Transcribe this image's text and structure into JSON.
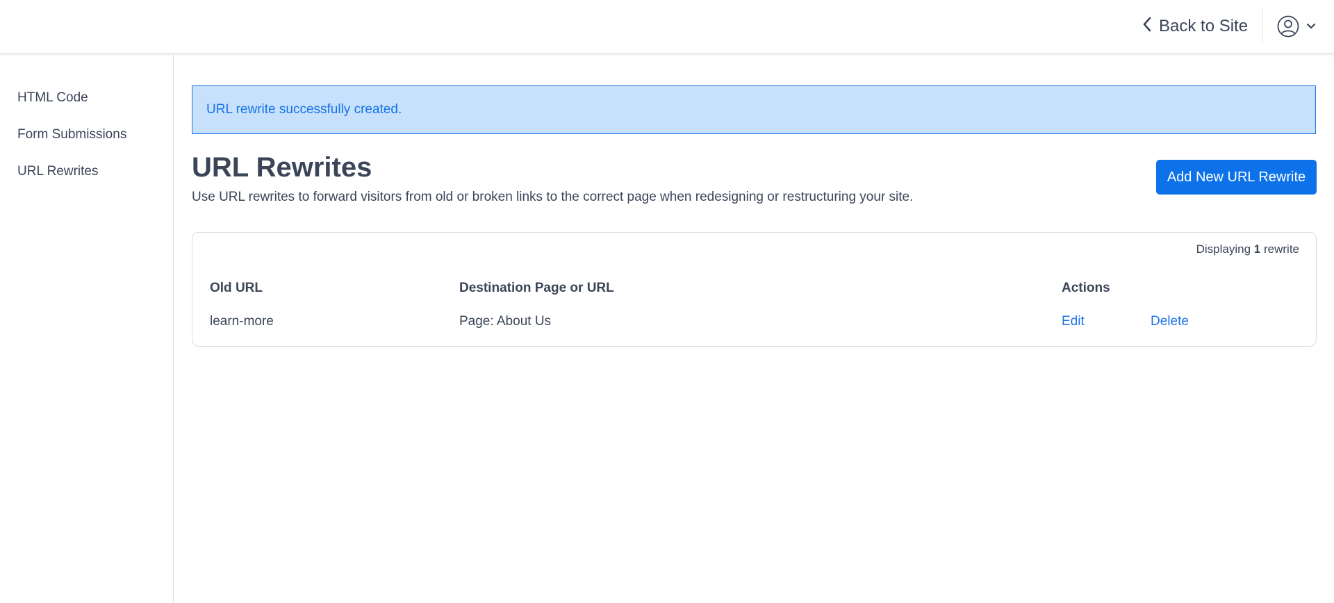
{
  "header": {
    "back_label": "Back to Site",
    "back_icon": "chevron-left-icon",
    "user_icon": "user-circle-icon",
    "menu_caret_icon": "chevron-down-icon"
  },
  "sidebar": {
    "items": [
      {
        "label": "HTML Code"
      },
      {
        "label": "Form Submissions"
      },
      {
        "label": "URL Rewrites"
      }
    ]
  },
  "alert": {
    "message": "URL rewrite successfully created."
  },
  "main": {
    "title": "URL Rewrites",
    "description": "Use URL rewrites to forward visitors from old or broken links to the correct page when redesigning or restructuring your site.",
    "add_button_label": "Add New URL Rewrite"
  },
  "table": {
    "count_prefix": "Displaying",
    "count_value": "1",
    "count_suffix": "rewrite",
    "columns": [
      "Old URL",
      "Destination Page or URL",
      "Actions"
    ],
    "rows": [
      {
        "old_url": "learn-more",
        "destination": "Page: About Us",
        "edit_label": "Edit",
        "delete_label": "Delete"
      }
    ]
  },
  "colors": {
    "accent": "#0d72ea",
    "alert_bg": "#c7e1fc",
    "alert_text": "#1573e6",
    "text": "#3b4558"
  }
}
